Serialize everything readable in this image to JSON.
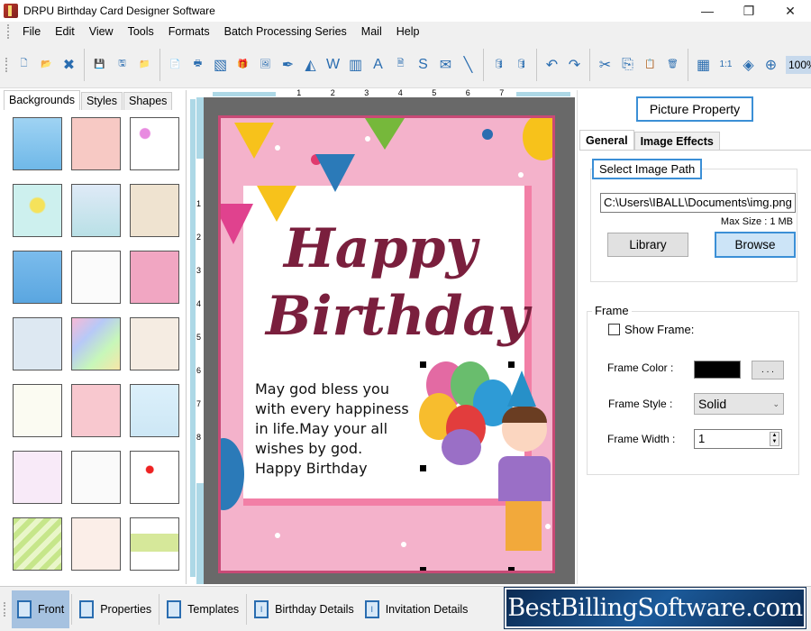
{
  "window": {
    "title": "DRPU Birthday Card Designer Software",
    "controls": {
      "minimize": "—",
      "maximize": "❐",
      "close": "✕"
    }
  },
  "menu": [
    "File",
    "Edit",
    "View",
    "Tools",
    "Formats",
    "Batch Processing Series",
    "Mail",
    "Help"
  ],
  "toolbar": {
    "groups": [
      [
        {
          "icon": "new-file-icon",
          "glyph": "🗋"
        },
        {
          "icon": "open-folder-icon",
          "glyph": "📂"
        },
        {
          "icon": "close-file-icon",
          "glyph": "✖"
        }
      ],
      [
        {
          "icon": "save-icon",
          "glyph": "💾"
        },
        {
          "icon": "save-as-icon",
          "glyph": "🖫"
        },
        {
          "icon": "export-icon",
          "glyph": "📁"
        }
      ],
      [
        {
          "icon": "properties-icon",
          "glyph": "📄"
        },
        {
          "icon": "print-icon",
          "glyph": "🖶"
        },
        {
          "icon": "background-icon",
          "glyph": "▧"
        },
        {
          "icon": "gift-icon",
          "glyph": "🎁"
        },
        {
          "icon": "insert-image-icon",
          "glyph": "🖼"
        },
        {
          "icon": "pen-icon",
          "glyph": "✒"
        },
        {
          "icon": "shapes-icon",
          "glyph": "◭"
        },
        {
          "icon": "watermark-icon",
          "glyph": "W"
        },
        {
          "icon": "barcode-icon",
          "glyph": "▥"
        },
        {
          "icon": "text-icon",
          "glyph": "A"
        },
        {
          "icon": "text-box-icon",
          "glyph": "🗎"
        },
        {
          "icon": "signature-icon",
          "glyph": "S"
        },
        {
          "icon": "mail-icon",
          "glyph": "✉"
        },
        {
          "icon": "line-icon",
          "glyph": "╲"
        }
      ],
      [
        {
          "icon": "database-add-icon",
          "glyph": "🛢"
        },
        {
          "icon": "database-icon",
          "glyph": "🛢"
        }
      ],
      [
        {
          "icon": "undo-icon",
          "glyph": "↶"
        },
        {
          "icon": "redo-icon",
          "glyph": "↷"
        }
      ],
      [
        {
          "icon": "cut-icon",
          "glyph": "✂"
        },
        {
          "icon": "copy-icon",
          "glyph": "⎘"
        },
        {
          "icon": "paste-icon",
          "glyph": "📋"
        },
        {
          "icon": "delete-icon",
          "glyph": "🗑"
        }
      ],
      [
        {
          "icon": "grid-icon",
          "glyph": "▦"
        },
        {
          "icon": "actual-size-icon",
          "glyph": "1:1"
        },
        {
          "icon": "fit-window-icon",
          "glyph": "◈"
        },
        {
          "icon": "zoom-in-icon",
          "glyph": "⊕"
        }
      ]
    ],
    "zoom_value": "100%",
    "zoom_out_glyph": "⊖"
  },
  "left_panel": {
    "tabs": [
      "Backgrounds",
      "Styles",
      "Shapes"
    ],
    "active_tab": "Backgrounds",
    "thumbnails": [
      {
        "name": "clouds",
        "bg": "linear-gradient(#9fd3f3,#6fb8e8)"
      },
      {
        "name": "pink-pattern",
        "bg": "#f7c9c4"
      },
      {
        "name": "butterflies",
        "bg": "radial-gradient(circle at 30% 30%,#e88be0 10%,#fff 12%)"
      },
      {
        "name": "flowers",
        "bg": "radial-gradient(circle at 50% 40%,#f5e25a 18%,#cdf0ee 22%)"
      },
      {
        "name": "bears",
        "bg": "linear-gradient(#dfeaf7,#b9e0e6)"
      },
      {
        "name": "bird-balloons",
        "bg": "#efe3d0"
      },
      {
        "name": "stars",
        "bg": "linear-gradient(#7bbcec,#5aa6e0)"
      },
      {
        "name": "white-balloons",
        "bg": "#fbfbfb"
      },
      {
        "name": "pink-cakes",
        "bg": "#f1a6c2"
      },
      {
        "name": "bubbles",
        "bg": "#dde8f2"
      },
      {
        "name": "rainbow",
        "bg": "linear-gradient(135deg,#f7b9d6,#b7c9f7,#c7f7b9,#f7e6a8)"
      },
      {
        "name": "teddy",
        "bg": "#f5ece2"
      },
      {
        "name": "happy-birthday",
        "bg": "#fbfbf2"
      },
      {
        "name": "pink-hearts-stripes",
        "bg": "#f8c8cf"
      },
      {
        "name": "balloons-sky",
        "bg": "linear-gradient(#dcf0fb,#cde7f5)"
      },
      {
        "name": "outline-hearts",
        "bg": "#f8eaf8"
      },
      {
        "name": "balloon-bunches",
        "bg": "#fafafa"
      },
      {
        "name": "red-hearts",
        "bg": "radial-gradient(circle at 40% 35%,#e22 8%,#fff 10%)"
      },
      {
        "name": "green-stripes",
        "bg": "repeating-linear-gradient(135deg,#c6e68a 0 6px,#e9f6c9 6px 12px)"
      },
      {
        "name": "cakes-pattern",
        "bg": "#fbeee8"
      },
      {
        "name": "meadow",
        "bg": "linear-gradient(#fff 30%,#d6e89a 30% 65%,#fff 65%)"
      }
    ]
  },
  "rulers": {
    "horizontal": [
      "1",
      "2",
      "3",
      "4",
      "5",
      "6",
      "7"
    ],
    "vertical": [
      "1",
      "2",
      "3",
      "4",
      "5",
      "6",
      "7",
      "8"
    ]
  },
  "card": {
    "title_line1": "Happy",
    "title_line2": "Birthday",
    "message": "May god bless you\nwith every happiness\n in life.May your all\nwishes by god.\nHappy Birthday"
  },
  "right_panel": {
    "title": "Picture Property",
    "tabs": [
      "General",
      "Image Effects"
    ],
    "active_tab": "General",
    "image_path_group": {
      "legend": "Select Image Path",
      "path_value": "C:\\Users\\IBALL\\Documents\\img.png",
      "max_size": "Max Size : 1 MB",
      "library_label": "Library",
      "browse_label": "Browse"
    },
    "frame_group": {
      "legend": "Frame",
      "show_frame_label": "Show Frame:",
      "show_frame_checked": false,
      "frame_color_label": "Frame Color :",
      "frame_color_value": "#000000",
      "color_picker_label": ". . .",
      "frame_style_label": "Frame Style :",
      "frame_style_value": "Solid",
      "frame_width_label": "Frame Width :",
      "frame_width_value": "1"
    }
  },
  "bottom_bar": {
    "items": [
      {
        "label": "Front",
        "icon": "front-page-icon",
        "active": true
      },
      {
        "label": "Properties",
        "icon": "properties-icon",
        "active": false
      },
      {
        "label": "Templates",
        "icon": "templates-icon",
        "active": false
      },
      {
        "label": "Birthday Details",
        "icon": "birthday-details-icon",
        "active": false
      },
      {
        "label": "Invitation Details",
        "icon": "invitation-details-icon",
        "active": false
      }
    ],
    "brand": "BestBillingSoftware.com"
  },
  "colors": {
    "accent_blue": "#3b8fd6",
    "card_title": "#7a1f3d",
    "card_pink": "#f4b2cb",
    "card_border": "#c84a76"
  }
}
